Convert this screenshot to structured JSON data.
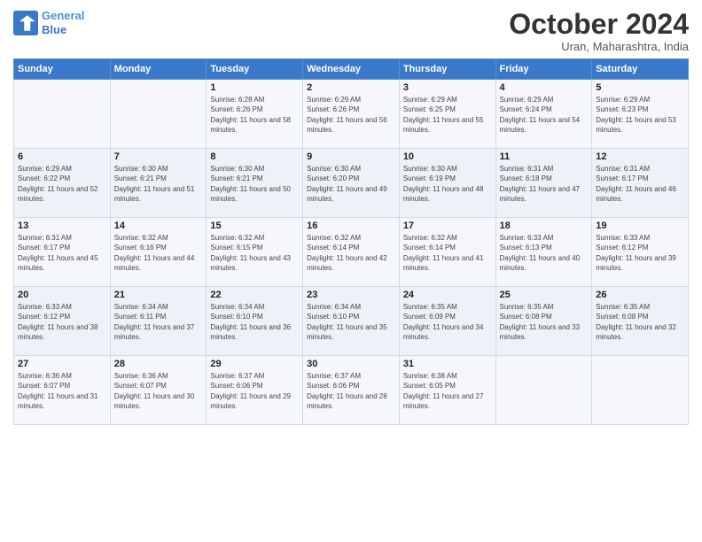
{
  "header": {
    "logo_line1": "General",
    "logo_line2": "Blue",
    "month_title": "October 2024",
    "subtitle": "Uran, Maharashtra, India"
  },
  "weekdays": [
    "Sunday",
    "Monday",
    "Tuesday",
    "Wednesday",
    "Thursday",
    "Friday",
    "Saturday"
  ],
  "weeks": [
    [
      {
        "day": "",
        "info": ""
      },
      {
        "day": "",
        "info": ""
      },
      {
        "day": "1",
        "info": "Sunrise: 6:28 AM\nSunset: 6:26 PM\nDaylight: 11 hours and 58 minutes."
      },
      {
        "day": "2",
        "info": "Sunrise: 6:29 AM\nSunset: 6:26 PM\nDaylight: 11 hours and 56 minutes."
      },
      {
        "day": "3",
        "info": "Sunrise: 6:29 AM\nSunset: 6:25 PM\nDaylight: 11 hours and 55 minutes."
      },
      {
        "day": "4",
        "info": "Sunrise: 6:29 AM\nSunset: 6:24 PM\nDaylight: 11 hours and 54 minutes."
      },
      {
        "day": "5",
        "info": "Sunrise: 6:29 AM\nSunset: 6:23 PM\nDaylight: 11 hours and 53 minutes."
      }
    ],
    [
      {
        "day": "6",
        "info": "Sunrise: 6:29 AM\nSunset: 6:22 PM\nDaylight: 11 hours and 52 minutes."
      },
      {
        "day": "7",
        "info": "Sunrise: 6:30 AM\nSunset: 6:21 PM\nDaylight: 11 hours and 51 minutes."
      },
      {
        "day": "8",
        "info": "Sunrise: 6:30 AM\nSunset: 6:21 PM\nDaylight: 11 hours and 50 minutes."
      },
      {
        "day": "9",
        "info": "Sunrise: 6:30 AM\nSunset: 6:20 PM\nDaylight: 11 hours and 49 minutes."
      },
      {
        "day": "10",
        "info": "Sunrise: 6:30 AM\nSunset: 6:19 PM\nDaylight: 11 hours and 48 minutes."
      },
      {
        "day": "11",
        "info": "Sunrise: 6:31 AM\nSunset: 6:18 PM\nDaylight: 11 hours and 47 minutes."
      },
      {
        "day": "12",
        "info": "Sunrise: 6:31 AM\nSunset: 6:17 PM\nDaylight: 11 hours and 46 minutes."
      }
    ],
    [
      {
        "day": "13",
        "info": "Sunrise: 6:31 AM\nSunset: 6:17 PM\nDaylight: 11 hours and 45 minutes."
      },
      {
        "day": "14",
        "info": "Sunrise: 6:32 AM\nSunset: 6:16 PM\nDaylight: 11 hours and 44 minutes."
      },
      {
        "day": "15",
        "info": "Sunrise: 6:32 AM\nSunset: 6:15 PM\nDaylight: 11 hours and 43 minutes."
      },
      {
        "day": "16",
        "info": "Sunrise: 6:32 AM\nSunset: 6:14 PM\nDaylight: 11 hours and 42 minutes."
      },
      {
        "day": "17",
        "info": "Sunrise: 6:32 AM\nSunset: 6:14 PM\nDaylight: 11 hours and 41 minutes."
      },
      {
        "day": "18",
        "info": "Sunrise: 6:33 AM\nSunset: 6:13 PM\nDaylight: 11 hours and 40 minutes."
      },
      {
        "day": "19",
        "info": "Sunrise: 6:33 AM\nSunset: 6:12 PM\nDaylight: 11 hours and 39 minutes."
      }
    ],
    [
      {
        "day": "20",
        "info": "Sunrise: 6:33 AM\nSunset: 6:12 PM\nDaylight: 11 hours and 38 minutes."
      },
      {
        "day": "21",
        "info": "Sunrise: 6:34 AM\nSunset: 6:11 PM\nDaylight: 11 hours and 37 minutes."
      },
      {
        "day": "22",
        "info": "Sunrise: 6:34 AM\nSunset: 6:10 PM\nDaylight: 11 hours and 36 minutes."
      },
      {
        "day": "23",
        "info": "Sunrise: 6:34 AM\nSunset: 6:10 PM\nDaylight: 11 hours and 35 minutes."
      },
      {
        "day": "24",
        "info": "Sunrise: 6:35 AM\nSunset: 6:09 PM\nDaylight: 11 hours and 34 minutes."
      },
      {
        "day": "25",
        "info": "Sunrise: 6:35 AM\nSunset: 6:08 PM\nDaylight: 11 hours and 33 minutes."
      },
      {
        "day": "26",
        "info": "Sunrise: 6:35 AM\nSunset: 6:08 PM\nDaylight: 11 hours and 32 minutes."
      }
    ],
    [
      {
        "day": "27",
        "info": "Sunrise: 6:36 AM\nSunset: 6:07 PM\nDaylight: 11 hours and 31 minutes."
      },
      {
        "day": "28",
        "info": "Sunrise: 6:36 AM\nSunset: 6:07 PM\nDaylight: 11 hours and 30 minutes."
      },
      {
        "day": "29",
        "info": "Sunrise: 6:37 AM\nSunset: 6:06 PM\nDaylight: 11 hours and 29 minutes."
      },
      {
        "day": "30",
        "info": "Sunrise: 6:37 AM\nSunset: 6:06 PM\nDaylight: 11 hours and 28 minutes."
      },
      {
        "day": "31",
        "info": "Sunrise: 6:38 AM\nSunset: 6:05 PM\nDaylight: 11 hours and 27 minutes."
      },
      {
        "day": "",
        "info": ""
      },
      {
        "day": "",
        "info": ""
      }
    ]
  ]
}
